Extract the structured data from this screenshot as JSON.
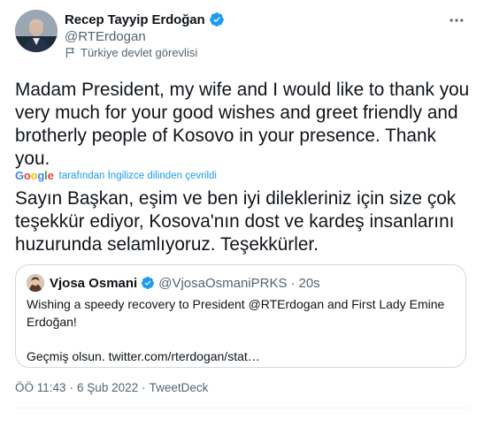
{
  "author": {
    "name": "Recep Tayyip Erdoğan",
    "handle": "@RTErdogan",
    "label": "Türkiye devlet görevlisi"
  },
  "tweet": {
    "text": "Madam President, my wife and I would like to thank you very much for your good wishes and greet friendly and brotherly people of Kosovo in your presence. Thank you.",
    "translated_by": "tarafından İngilizce dilinden çevrildi",
    "translation": "Sayın Başkan, eşim ve ben iyi dilekleriniz için size çok teşekkür ediyor, Kosova'nın dost ve kardeş insanlarını huzurunda selamlıyoruz. Teşekkürler."
  },
  "quote": {
    "name": "Vjosa Osmani",
    "handle": "@VjosaOsmaniPRKS",
    "separator": "·",
    "time": "20s",
    "line1": "Wishing a speedy recovery to President @RTErdogan and First Lady Emine Erdoğan!",
    "line2": "Geçmiş olsun. twitter.com/rterdogan/stat…"
  },
  "meta": {
    "time": "ÖÖ 11:43",
    "sep1": "·",
    "date": "6 Şub 2022",
    "sep2": "·",
    "source": "TweetDeck"
  },
  "colors": {
    "verified": "#1d9bf0",
    "link": "#1d9bf0",
    "secondary_text": "#536471",
    "border": "#cfd9de"
  },
  "icons": {
    "verified": "verified-badge-icon",
    "label": "flag-icon",
    "more": "more-horizontal-icon",
    "google": "google-logo"
  }
}
